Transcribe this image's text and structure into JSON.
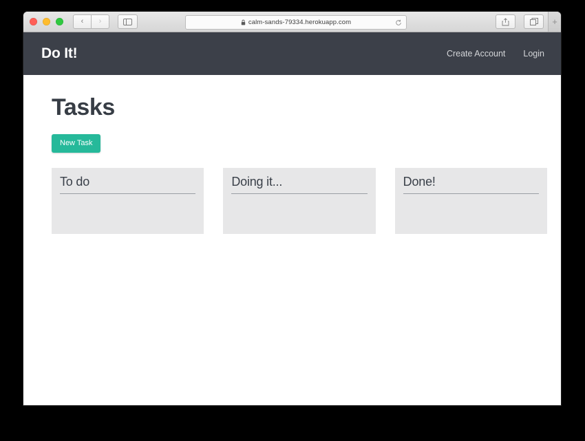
{
  "browser": {
    "traffic_lights": [
      "close",
      "minimize",
      "maximize"
    ],
    "back_label": "‹",
    "forward_label": "›",
    "sidebar_icon": "sidebar-icon",
    "url": "calm-sands-79334.herokuapp.com",
    "secure_icon": "lock-icon",
    "reload_icon": "reload-icon",
    "share_icon": "share-icon",
    "tabs_icon": "tabs-icon",
    "new_tab_label": "+"
  },
  "navbar": {
    "brand": "Do It!",
    "links": [
      {
        "label": "Create Account"
      },
      {
        "label": "Login"
      }
    ]
  },
  "main": {
    "title": "Tasks",
    "new_task_label": "New Task",
    "columns": [
      {
        "title": "To do",
        "tasks": []
      },
      {
        "title": "Doing it...",
        "tasks": []
      },
      {
        "title": "Done!",
        "tasks": []
      }
    ]
  },
  "colors": {
    "navbar_bg": "#3c4049",
    "accent": "#26b99a",
    "panel_bg": "#e7e7e8",
    "heading": "#373d45",
    "page_bg": "#ffffff",
    "desktop_bg": "#000000"
  }
}
